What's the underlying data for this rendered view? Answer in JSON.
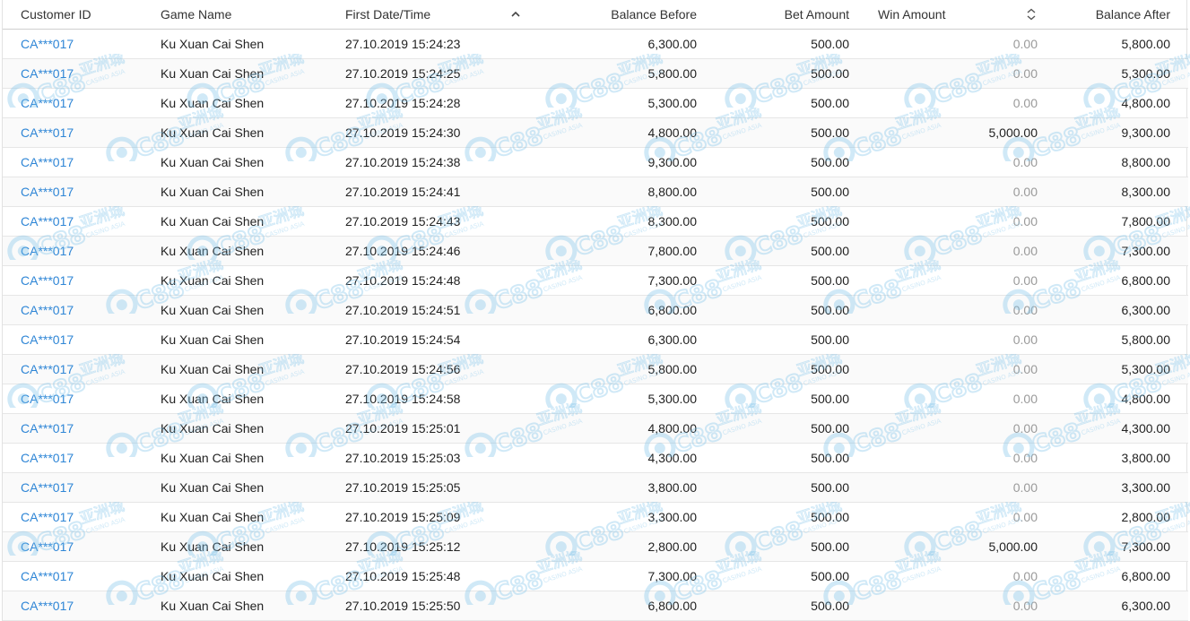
{
  "colors": {
    "link": "#2f86d6",
    "muted": "#9a9a9a",
    "watermark": "#7cc2ea"
  },
  "watermark": {
    "brand": "C88",
    "chinese": "亚洲城",
    "subtitle": "CASINO ASIA"
  },
  "table": {
    "headers": {
      "customer_id": "Customer ID",
      "game_name": "Game Name",
      "first_date": "First Date/Time",
      "balance_before": "Balance Before",
      "bet_amount": "Bet Amount",
      "win_amount": "Win Amount",
      "balance_after": "Balance After"
    },
    "sort_icons": {
      "first_date": "sort-ascending-icon",
      "win_amount": "sort-both-icon"
    },
    "rows": [
      {
        "customer_id": "CA***017",
        "game": "Ku Xuan Cai Shen",
        "date": "27.10.2019 15:24:23",
        "balance_before": "6,300.00",
        "bet": "500.00",
        "win": "0.00",
        "balance_after": "5,800.00"
      },
      {
        "customer_id": "CA***017",
        "game": "Ku Xuan Cai Shen",
        "date": "27.10.2019 15:24:25",
        "balance_before": "5,800.00",
        "bet": "500.00",
        "win": "0.00",
        "balance_after": "5,300.00"
      },
      {
        "customer_id": "CA***017",
        "game": "Ku Xuan Cai Shen",
        "date": "27.10.2019 15:24:28",
        "balance_before": "5,300.00",
        "bet": "500.00",
        "win": "0.00",
        "balance_after": "4,800.00"
      },
      {
        "customer_id": "CA***017",
        "game": "Ku Xuan Cai Shen",
        "date": "27.10.2019 15:24:30",
        "balance_before": "4,800.00",
        "bet": "500.00",
        "win": "5,000.00",
        "balance_after": "9,300.00"
      },
      {
        "customer_id": "CA***017",
        "game": "Ku Xuan Cai Shen",
        "date": "27.10.2019 15:24:38",
        "balance_before": "9,300.00",
        "bet": "500.00",
        "win": "0.00",
        "balance_after": "8,800.00"
      },
      {
        "customer_id": "CA***017",
        "game": "Ku Xuan Cai Shen",
        "date": "27.10.2019 15:24:41",
        "balance_before": "8,800.00",
        "bet": "500.00",
        "win": "0.00",
        "balance_after": "8,300.00"
      },
      {
        "customer_id": "CA***017",
        "game": "Ku Xuan Cai Shen",
        "date": "27.10.2019 15:24:43",
        "balance_before": "8,300.00",
        "bet": "500.00",
        "win": "0.00",
        "balance_after": "7,800.00"
      },
      {
        "customer_id": "CA***017",
        "game": "Ku Xuan Cai Shen",
        "date": "27.10.2019 15:24:46",
        "balance_before": "7,800.00",
        "bet": "500.00",
        "win": "0.00",
        "balance_after": "7,300.00"
      },
      {
        "customer_id": "CA***017",
        "game": "Ku Xuan Cai Shen",
        "date": "27.10.2019 15:24:48",
        "balance_before": "7,300.00",
        "bet": "500.00",
        "win": "0.00",
        "balance_after": "6,800.00"
      },
      {
        "customer_id": "CA***017",
        "game": "Ku Xuan Cai Shen",
        "date": "27.10.2019 15:24:51",
        "balance_before": "6,800.00",
        "bet": "500.00",
        "win": "0.00",
        "balance_after": "6,300.00"
      },
      {
        "customer_id": "CA***017",
        "game": "Ku Xuan Cai Shen",
        "date": "27.10.2019 15:24:54",
        "balance_before": "6,300.00",
        "bet": "500.00",
        "win": "0.00",
        "balance_after": "5,800.00"
      },
      {
        "customer_id": "CA***017",
        "game": "Ku Xuan Cai Shen",
        "date": "27.10.2019 15:24:56",
        "balance_before": "5,800.00",
        "bet": "500.00",
        "win": "0.00",
        "balance_after": "5,300.00"
      },
      {
        "customer_id": "CA***017",
        "game": "Ku Xuan Cai Shen",
        "date": "27.10.2019 15:24:58",
        "balance_before": "5,300.00",
        "bet": "500.00",
        "win": "0.00",
        "balance_after": "4,800.00"
      },
      {
        "customer_id": "CA***017",
        "game": "Ku Xuan Cai Shen",
        "date": "27.10.2019 15:25:01",
        "balance_before": "4,800.00",
        "bet": "500.00",
        "win": "0.00",
        "balance_after": "4,300.00"
      },
      {
        "customer_id": "CA***017",
        "game": "Ku Xuan Cai Shen",
        "date": "27.10.2019 15:25:03",
        "balance_before": "4,300.00",
        "bet": "500.00",
        "win": "0.00",
        "balance_after": "3,800.00"
      },
      {
        "customer_id": "CA***017",
        "game": "Ku Xuan Cai Shen",
        "date": "27.10.2019 15:25:05",
        "balance_before": "3,800.00",
        "bet": "500.00",
        "win": "0.00",
        "balance_after": "3,300.00"
      },
      {
        "customer_id": "CA***017",
        "game": "Ku Xuan Cai Shen",
        "date": "27.10.2019 15:25:09",
        "balance_before": "3,300.00",
        "bet": "500.00",
        "win": "0.00",
        "balance_after": "2,800.00"
      },
      {
        "customer_id": "CA***017",
        "game": "Ku Xuan Cai Shen",
        "date": "27.10.2019 15:25:12",
        "balance_before": "2,800.00",
        "bet": "500.00",
        "win": "5,000.00",
        "balance_after": "7,300.00"
      },
      {
        "customer_id": "CA***017",
        "game": "Ku Xuan Cai Shen",
        "date": "27.10.2019 15:25:48",
        "balance_before": "7,300.00",
        "bet": "500.00",
        "win": "0.00",
        "balance_after": "6,800.00"
      },
      {
        "customer_id": "CA***017",
        "game": "Ku Xuan Cai Shen",
        "date": "27.10.2019 15:25:50",
        "balance_before": "6,800.00",
        "bet": "500.00",
        "win": "0.00",
        "balance_after": "6,300.00"
      }
    ]
  }
}
